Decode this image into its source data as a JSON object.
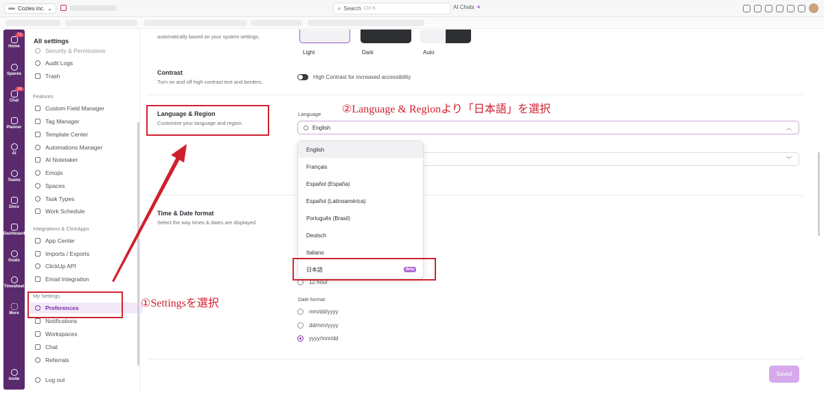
{
  "topbar": {
    "workspace": "Cozies inc.",
    "search_label": "Search",
    "search_shortcut": "Ctrl K",
    "ai_chats": "AI Chats"
  },
  "rail": {
    "home": "Home",
    "home_badge": "72",
    "spaces": "Spaces",
    "chat": "Chat",
    "chat_badge": "16",
    "planner": "Planner",
    "ai": "AI",
    "teams": "Teams",
    "docs": "Docs",
    "dashboards": "Dashboard",
    "goals": "Goals",
    "timesheet": "Timesheet",
    "more": "More",
    "invite": "Invite"
  },
  "sidebar": {
    "title": "All settings",
    "security": "Security & Permissions",
    "audit_logs": "Audit Logs",
    "trash": "Trash",
    "features_header": "Features",
    "custom_field_manager": "Custom Field Manager",
    "tag_manager": "Tag Manager",
    "template_center": "Template Center",
    "automations_manager": "Automations Manager",
    "ai_notetaker": "AI Notetaker",
    "emojis": "Emojis",
    "spaces": "Spaces",
    "task_types": "Task Types",
    "work_schedule": "Work Schedule",
    "integrations_header": "Integrations & ClickApps",
    "app_center": "App Center",
    "imports_exports": "Imports / Exports",
    "clickup_api": "ClickUp API",
    "email_integration": "Email Integration",
    "my_settings_header": "My Settings",
    "preferences": "Preferences",
    "notifications": "Notifications",
    "workspaces": "Workspaces",
    "chat": "Chat",
    "referrals": "Referrals",
    "logout": "Log out"
  },
  "main": {
    "theme_desc": "automatically based on your system settings.",
    "theme_light": "Light",
    "theme_dark": "Dark",
    "theme_auto": "Auto",
    "contrast_title": "Contrast",
    "contrast_desc": "Turn on and off high contrast text and borders.",
    "contrast_toggle_label": "High Contrast for increased accessibility",
    "lang_title": "Language & Region",
    "lang_desc": "Customize your language and region.",
    "language_label": "Language",
    "language_value": "English",
    "time_title": "Time & Date format",
    "time_desc": "Select the way times & dates are displayed.",
    "time_12h": "12 hour",
    "date_format_label": "Date format",
    "date_opt1": "mm/dd/yyyy",
    "date_opt2": "dd/mm/yyyy",
    "date_opt3": "yyyy/mm/dd",
    "saved_button": "Saved"
  },
  "language_options": [
    "English",
    "Français",
    "Español (España)",
    "Español (Latinoamérica)",
    "Português (Brasil)",
    "Deutsch",
    "Italiano",
    "日本語"
  ],
  "beta_badge": "Beta",
  "annotations": {
    "step1": "①Settingsを選択",
    "step2": "②Language & Regionより「日本語」を選択"
  },
  "colors": {
    "accent": "#7b2fa8",
    "rail": "#5a2a6d",
    "annotation": "#d0202e"
  }
}
